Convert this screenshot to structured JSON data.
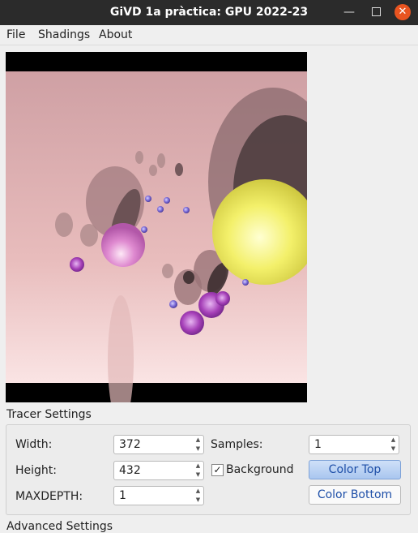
{
  "window": {
    "title": "GiVD 1a pràctica: GPU 2022-23"
  },
  "menu": {
    "items": [
      "File",
      "Shadings",
      "About"
    ]
  },
  "viewport": {
    "background_top": "#cf9fa3",
    "background_bottom": "#f9e3e3"
  },
  "tracer": {
    "group_title": "Tracer Settings",
    "width_label": "Width:",
    "width_value": "372",
    "height_label": "Height:",
    "height_value": "432",
    "maxdepth_label": "MAXDEPTH:",
    "maxdepth_value": "1",
    "samples_label": "Samples:",
    "samples_value": "1",
    "background_label": "Background",
    "background_checked": true,
    "color_top_label": "Color Top",
    "color_bottom_label": "Color Bottom"
  },
  "advanced": {
    "group_title": "Advanced Settings"
  },
  "colors": {
    "accent": "#e95420",
    "button_text": "#1e4fa8"
  }
}
